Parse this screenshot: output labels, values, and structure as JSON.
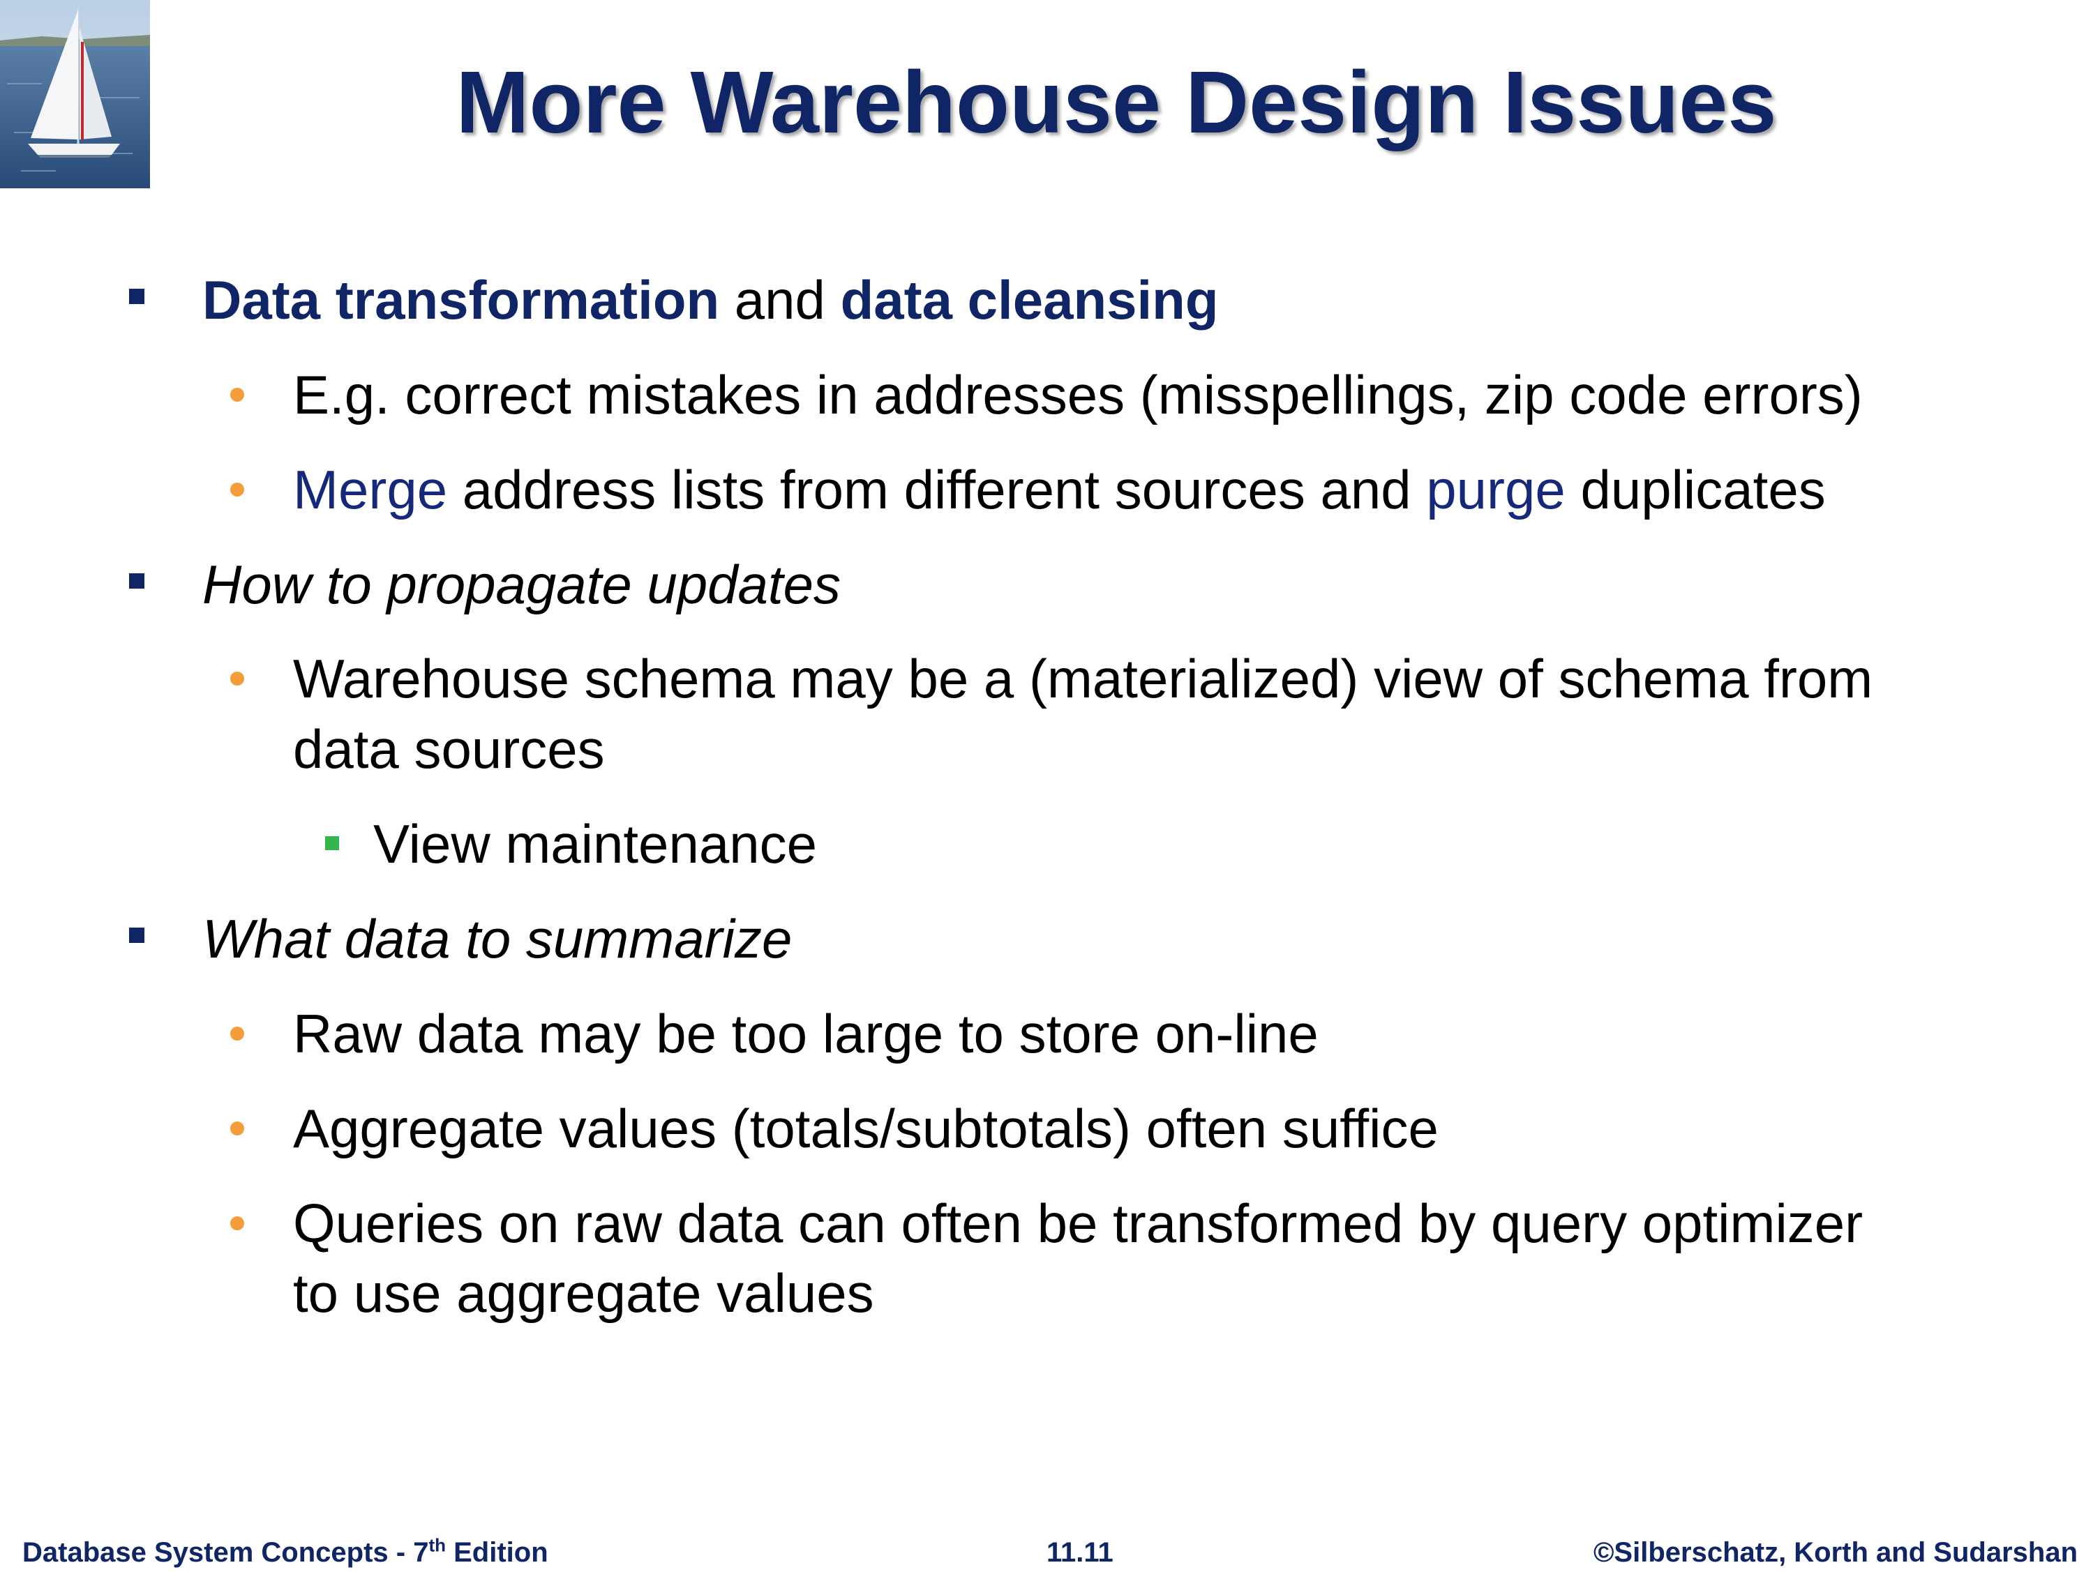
{
  "slide": {
    "title": "More Warehouse Design Issues",
    "bullets": {
      "b1_bold1": "Data transformation",
      "b1_mid": " and ",
      "b1_bold2": "data cleansing",
      "b1_s1": "E.g. correct mistakes in addresses (misspellings, zip code errors)",
      "b1_s2_kw1": "Merge",
      "b1_s2_mid": " address lists from different sources and ",
      "b1_s2_kw2": "purge",
      "b1_s2_end": " duplicates",
      "b2": "How to propagate updates",
      "b2_s1_line1": "Warehouse schema may be a (materialized) view of schema from",
      "b2_s1_line2": "data sources",
      "b2_s1_sub": "View maintenance",
      "b3": "What data to summarize",
      "b3_s1": "Raw data may be too large to store on-line",
      "b3_s2": "Aggregate values (totals/subtotals) often suffice",
      "b3_s3_line1": "Queries on raw data can often be transformed by query optimizer",
      "b3_s3_line2": "to use aggregate values"
    }
  },
  "footer": {
    "left_pre": "Database System Concepts - 7",
    "left_sup": "th",
    "left_post": " Edition",
    "center": "11.11",
    "right": "©Silberschatz, Korth and Sudarshan"
  },
  "colors": {
    "title": "#0f2566",
    "keyword": "#15287a",
    "bullet_primary": "#0f2566",
    "bullet_secondary": "#f59c3a",
    "bullet_tertiary": "#33b64b"
  },
  "icons": {
    "logo": "sailboat-logo"
  }
}
